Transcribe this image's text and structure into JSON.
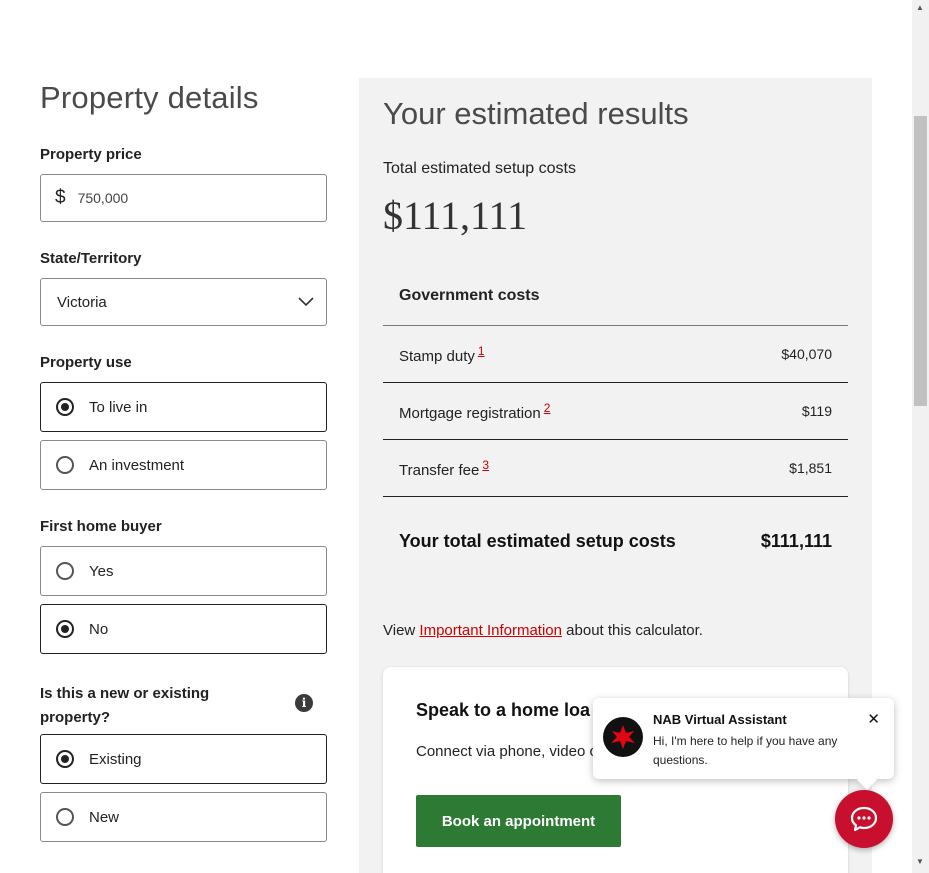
{
  "form": {
    "title": "Property details",
    "price_label": "Property price",
    "price_currency": "$",
    "price_value": "750,000",
    "state_label": "State/Territory",
    "state_value": "Victoria",
    "use_label": "Property use",
    "use_options": [
      "To live in",
      "An investment"
    ],
    "use_selected": "To live in",
    "fhb_label": "First home buyer",
    "fhb_options": [
      "Yes",
      "No"
    ],
    "fhb_selected": "No",
    "newexist_label": "Is this a new or existing property?",
    "newexist_options": [
      "Existing",
      "New"
    ],
    "newexist_selected": "Existing",
    "info_icon": "i"
  },
  "results": {
    "title": "Your estimated results",
    "total_label": "Total estimated setup costs",
    "total_value": "$111,111",
    "gov_heading": "Government costs",
    "rows": [
      {
        "label": "Stamp duty",
        "note": "1",
        "amount": "$40,070"
      },
      {
        "label": "Mortgage registration",
        "note": "2",
        "amount": "$119"
      },
      {
        "label": "Transfer fee",
        "note": "3",
        "amount": "$1,851"
      }
    ],
    "total_row_label": "Your total estimated setup costs",
    "total_row_amount": "$111,111",
    "info_prefix": "View ",
    "info_link": "Important Information",
    "info_suffix": " about this calculator."
  },
  "speak": {
    "title": "Speak to a home loa",
    "text": "Connect via phone, video c",
    "button": "Book an appointment"
  },
  "chat": {
    "title": "NAB Virtual Assistant",
    "message": "Hi, I'm here to help if you have any questions.",
    "close": "✕",
    "logo_icon": "nab-star-icon",
    "launcher_icon": "chat-bubble-icon"
  },
  "colors": {
    "accent_red": "#c8102e",
    "book_green": "#2c7a34",
    "panel_grey": "#f2f2f2"
  }
}
